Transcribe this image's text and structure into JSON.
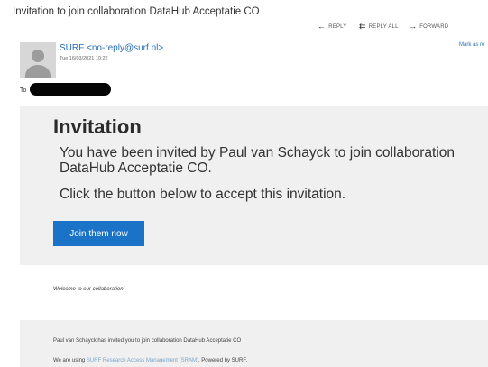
{
  "email": {
    "subject": "Invitation to join collaboration DataHub Acceptatie CO",
    "actions": {
      "reply": "REPLY",
      "reply_all": "REPLY ALL",
      "forward": "FORWARD"
    },
    "sender": "SURF <no-reply@surf.nl>",
    "date": "Tue 16/03/2021 10:22",
    "mark_as_read": "Mark as re",
    "to_label": "To"
  },
  "body": {
    "title": "Invitation",
    "invite_text": "You have been invited by Paul van Schayck to join collaboration DataHub Acceptatie CO.",
    "instruction": "Click the button below to accept this invitation.",
    "button_label": "Join them now",
    "welcome": "Welcome to our collaboration!"
  },
  "footer": {
    "line1": "Paul van Schayck has invited you to join collaboration DataHub Acceptatie CO",
    "line2_prefix": "We are using ",
    "line2_link": "SURF Research Access Management (SRAM)",
    "line2_suffix": ". Powered by SURF."
  },
  "colors": {
    "accent": "#1a73c7",
    "link": "#2a6fb8",
    "panel": "#f0f0f0"
  }
}
